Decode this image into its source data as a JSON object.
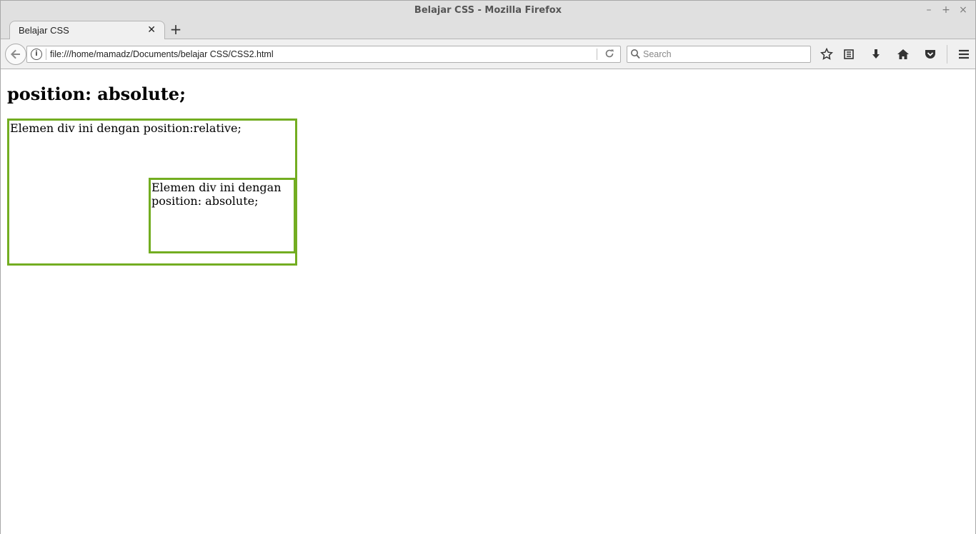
{
  "window": {
    "title": "Belajar CSS - Mozilla Firefox",
    "controls": {
      "minimize": "–",
      "maximize": "+",
      "close": "×"
    }
  },
  "tabs": [
    {
      "label": "Belajar CSS",
      "active": true
    }
  ],
  "navbar": {
    "url": "file:///home/mamadz/Documents/belajar CSS/CSS2.html",
    "search_placeholder": "Search",
    "icons": [
      "back-arrow-icon",
      "info-icon",
      "reload-icon",
      "search-icon",
      "bookmark-star-icon",
      "reading-list-icon",
      "download-icon",
      "home-icon",
      "pocket-icon",
      "menu-icon"
    ]
  },
  "page": {
    "heading": "position: absolute;",
    "relative_box_text": "Elemen div ini dengan position:relative;",
    "absolute_box_text": "Elemen div ini dengan position: absolute;"
  },
  "colors": {
    "box_border": "#73ad21"
  }
}
